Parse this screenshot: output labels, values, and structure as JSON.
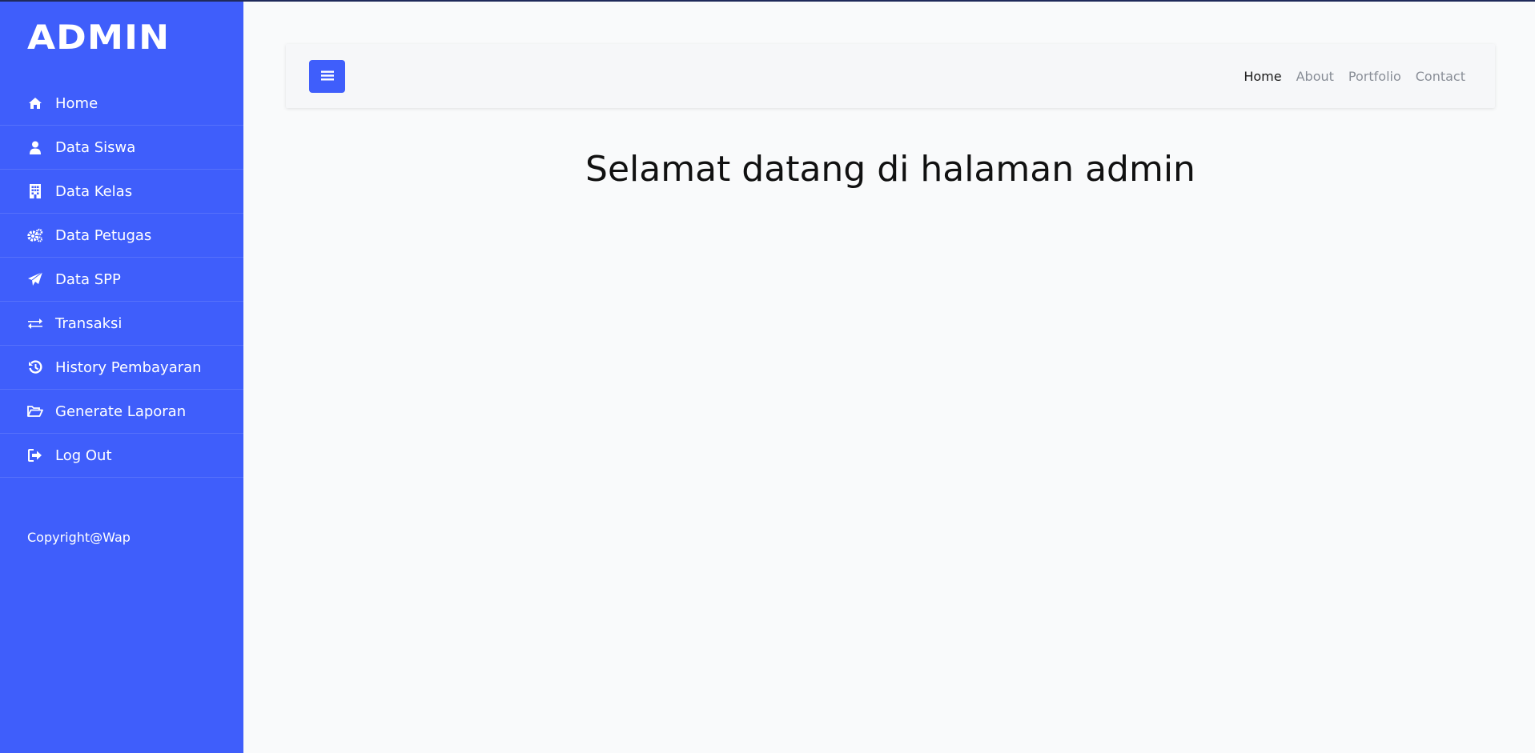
{
  "sidebar": {
    "brand": "ADMIN",
    "items": [
      {
        "label": "Home",
        "icon": "home-icon"
      },
      {
        "label": "Data Siswa",
        "icon": "user-icon"
      },
      {
        "label": "Data Kelas",
        "icon": "building-icon"
      },
      {
        "label": "Data Petugas",
        "icon": "cogs-icon"
      },
      {
        "label": "Data SPP",
        "icon": "paper-plane-icon"
      },
      {
        "label": "Transaksi",
        "icon": "exchange-icon"
      },
      {
        "label": "History Pembayaran",
        "icon": "history-icon"
      },
      {
        "label": "Generate Laporan",
        "icon": "folder-open-icon"
      },
      {
        "label": "Log Out",
        "icon": "sign-out-icon"
      }
    ],
    "copyright": "Copyright@Wap"
  },
  "navbar": {
    "toggle_icon": "hamburger-icon",
    "links": [
      "Home",
      "About",
      "Portfolio",
      "Contact"
    ],
    "active_link": "Home"
  },
  "main": {
    "heading": "Selamat datang di halaman admin"
  },
  "colors": {
    "sidebar_bg": "#3f5efb",
    "accent": "#3f5efb",
    "page_bg": "#f9fafb",
    "nav_inactive": "#8a8f98",
    "nav_active": "#1a1a1a"
  }
}
